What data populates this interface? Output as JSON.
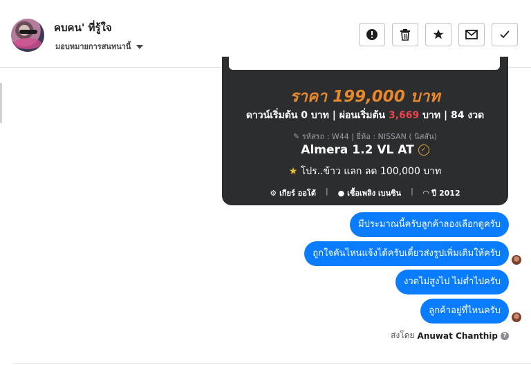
{
  "header": {
    "name": "คบคน' ที่รู้ใจ",
    "subtitle": "มอบหมายการสนทนานี้",
    "buttons": [
      {
        "name": "report-button",
        "icon": "exclamation-circle-icon"
      },
      {
        "name": "delete-button",
        "icon": "trash-icon"
      },
      {
        "name": "star-button",
        "icon": "star-icon"
      },
      {
        "name": "mail-button",
        "icon": "envelope-icon"
      },
      {
        "name": "done-button",
        "icon": "checkmark-icon"
      }
    ]
  },
  "card": {
    "price": "ราคา 199,000 บาท",
    "down_pre": "ดาวน์เริ่มต้น 0 บาท | ผ่อนเริ่มต้น",
    "installment": "3,669",
    "down_post": "บาท | 84 งวด",
    "meta": "รหัสรถ : W44 | ยี่ห้อ : NISSAN ( นิสสัน)",
    "model": "Almera 1.2 VL AT",
    "promo": "โปร..ข้าว แลก ลด 100,000 บาท",
    "gear": "เกียร์ ออโต้",
    "fuel": "เชื้อเพลิง เบนซิน",
    "year": "ปี 2012"
  },
  "messages": [
    "มีประมาณนี้ครับลูกค้าลองเลือกดูครับ",
    "ถูกใจคันไหนแจ้งได้ครับเดี๋ยวส่งรูปเพิ่มเติมให้ครับ",
    "งวดไม่สูงไป ไม่ต่ำไปครับ",
    "ลูกค้าอยู่ที่ไหนครับ"
  ],
  "sent_by_label": "ส่งโดย",
  "sent_by_name": "Anuwat Chanthip",
  "colors": {
    "bubble": "#0a7cff",
    "price": "#e8882b",
    "installment": "#e8434a",
    "card_bg": "#2c2d2f"
  }
}
